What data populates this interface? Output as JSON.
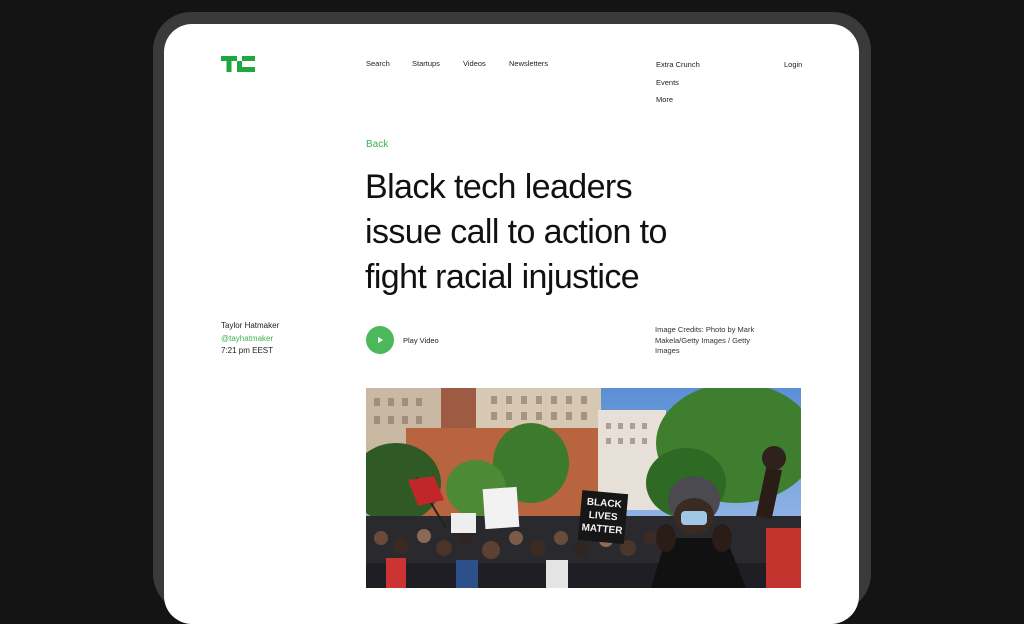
{
  "nav": {
    "search": "Search",
    "startups": "Startups",
    "videos": "Videos",
    "newsletters": "Newsletters",
    "extra_crunch": "Extra Crunch",
    "events": "Events",
    "more": "More",
    "login": "Login"
  },
  "article": {
    "back": "Back",
    "headline_lines": [
      "Black tech leaders",
      "issue call to action to",
      "fight racial injustice"
    ],
    "author": "Taylor Hatmaker",
    "handle": "@tayhatmaker",
    "time": "7:21 pm EEST",
    "play_label": "Play Video",
    "credits_lines": [
      "Image Credits: Photo by Mark",
      "Makela/Getty Images / Getty",
      "Images"
    ],
    "sign_text": [
      "BLACK",
      "LIVES",
      "MATTER"
    ]
  },
  "colors": {
    "accent": "#3fb34f",
    "background": "#141414",
    "device_frame": "#3a3a3a"
  }
}
